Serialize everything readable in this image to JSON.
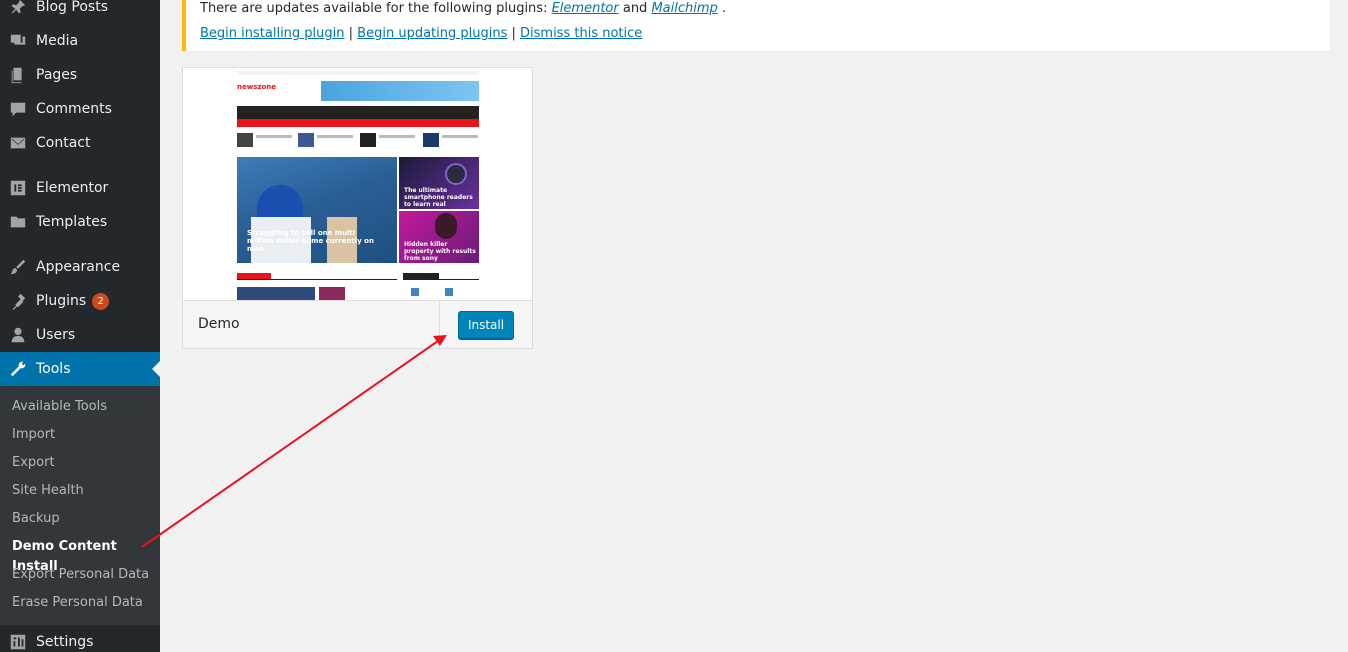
{
  "sidebar": {
    "items": [
      {
        "label": "Blog Posts",
        "icon": "pin-icon"
      },
      {
        "label": "Media",
        "icon": "media-icon"
      },
      {
        "label": "Pages",
        "icon": "pages-icon"
      },
      {
        "label": "Comments",
        "icon": "comment-icon"
      },
      {
        "label": "Contact",
        "icon": "mail-icon"
      },
      {
        "label": "Elementor",
        "icon": "elementor-icon"
      },
      {
        "label": "Templates",
        "icon": "folder-icon"
      },
      {
        "label": "Appearance",
        "icon": "brush-icon"
      },
      {
        "label": "Plugins",
        "icon": "plugin-icon",
        "badge": "2"
      },
      {
        "label": "Users",
        "icon": "user-icon"
      },
      {
        "label": "Tools",
        "icon": "wrench-icon",
        "active": true
      },
      {
        "label": "Settings",
        "icon": "settings-icon"
      }
    ],
    "submenu": [
      {
        "label": "Available Tools"
      },
      {
        "label": "Import"
      },
      {
        "label": "Export"
      },
      {
        "label": "Site Health"
      },
      {
        "label": "Backup"
      },
      {
        "label": "Demo Content Install",
        "current": true
      },
      {
        "label": "Export Personal Data"
      },
      {
        "label": "Erase Personal Data"
      }
    ]
  },
  "notice": {
    "text_prefix": "There are updates available for the following plugins: ",
    "plugin1": "Elementor",
    "and": " and ",
    "plugin2": "Mailchimp",
    "suffix": " .",
    "links": [
      "Begin installing plugin",
      "Begin updating plugins",
      "Dismiss this notice"
    ],
    "separator": " | "
  },
  "demo": {
    "name": "Demo",
    "install_label": "Install",
    "preview": {
      "logo": "newszone",
      "headline_main": "Struggling to sell one multi million dollar home currently on man",
      "headline_right1": "The ultimate smartphone readers to learn real",
      "headline_right2": "Hidden killer property with results from sony"
    }
  },
  "colors": {
    "sidebar_bg": "#23282d",
    "submenu_bg": "#32373c",
    "active_bg": "#0073aa",
    "notice_border": "#ffb900",
    "button_bg": "#0085ba",
    "badge_bg": "#ca4a1f",
    "arrow": "#e8131b"
  }
}
